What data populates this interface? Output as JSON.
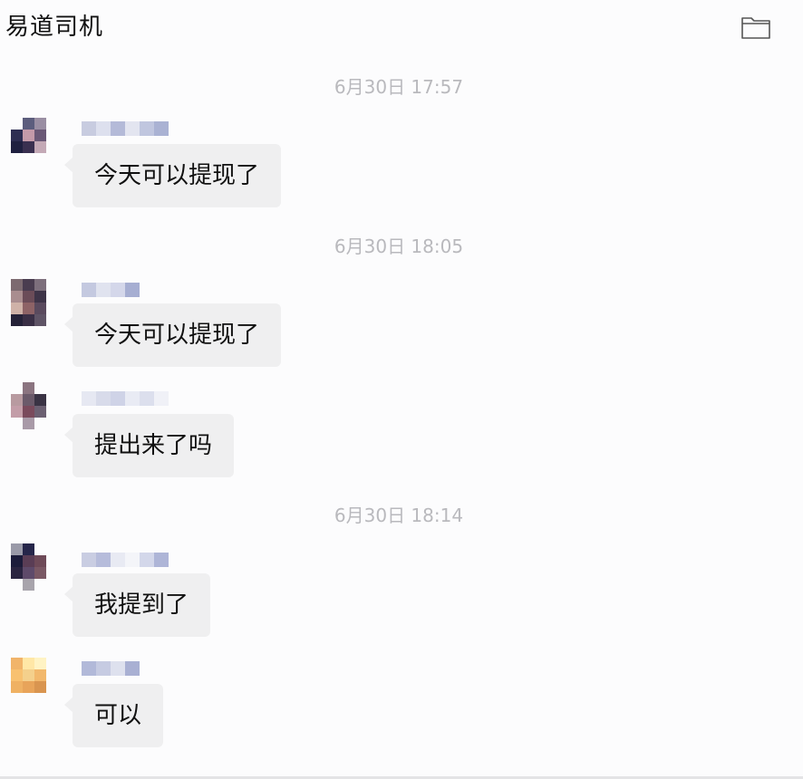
{
  "header": {
    "title": "易道司机",
    "folder_icon": "folder-icon"
  },
  "messages": [
    {
      "timestamp": "6月30日  17:57",
      "text": "今天可以提现了"
    },
    {
      "timestamp": "6月30日  18:05",
      "text": "今天可以提现了"
    },
    {
      "text": "提出来了吗"
    },
    {
      "timestamp": "6月30日  18:14",
      "text": "我提到了"
    },
    {
      "text": "可以"
    }
  ],
  "colors": {
    "bubble": "#efeff0",
    "timestamp": "#b9b9bd",
    "background": "#fcfcfd"
  }
}
